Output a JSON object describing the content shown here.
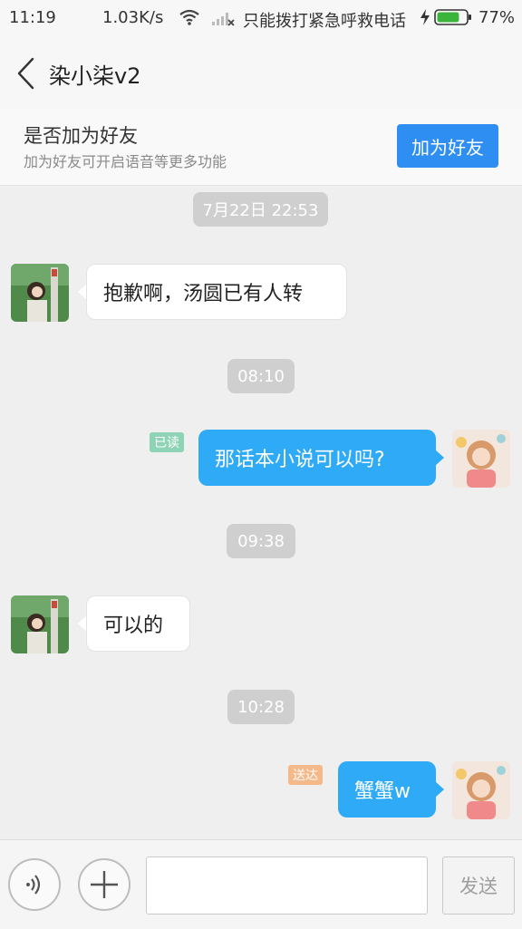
{
  "status_bar": {
    "time": "11:19",
    "speed": "1.03K/s",
    "call_text": "只能拨打紧急呼救电话",
    "battery_pct": "77%",
    "battery_level": 0.77
  },
  "header": {
    "title": "染小柒v2"
  },
  "friend_banner": {
    "question": "是否加为好友",
    "subtitle": "加为好友可开启语音等更多功能",
    "button_label": "加为好友"
  },
  "messages": [
    {
      "kind": "time",
      "text": "7月22日 22:53"
    },
    {
      "kind": "incoming",
      "text": "抱歉啊，汤圆已有人转"
    },
    {
      "kind": "time",
      "text": "08:10"
    },
    {
      "kind": "outgoing",
      "text": "那话本小说可以吗?",
      "status": "已读"
    },
    {
      "kind": "time",
      "text": "09:38"
    },
    {
      "kind": "incoming",
      "text": "可以的"
    },
    {
      "kind": "time",
      "text": "10:28"
    },
    {
      "kind": "outgoing",
      "text": "蟹蟹w",
      "status": "送达"
    }
  ],
  "input_bar": {
    "send_label": "发送"
  },
  "colors": {
    "accent_blue": "#2f8ef2",
    "bubble_out": "#2eaaf6",
    "read_badge": "#8fd3b6",
    "delivered_badge": "#f5b889"
  }
}
